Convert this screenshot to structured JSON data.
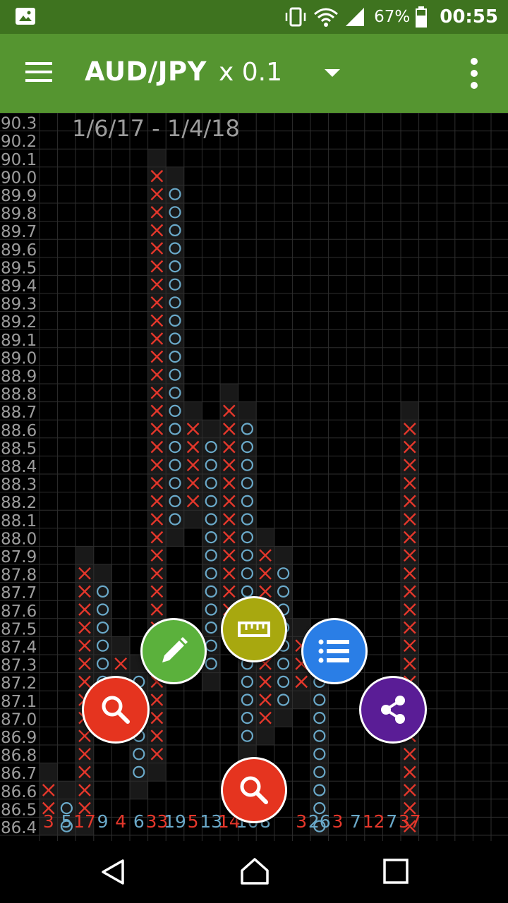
{
  "status_bar": {
    "battery": "67%",
    "time": "00:55",
    "icons": [
      "gallery-icon",
      "vibrate-icon",
      "wifi-icon",
      "signal-icon",
      "battery-icon"
    ]
  },
  "app_bar": {
    "symbol": "AUD/JPY",
    "box_size": "x 0.1",
    "icons": [
      "menu-icon",
      "dropdown-arrow-icon",
      "overflow-menu-icon"
    ]
  },
  "chart_data": {
    "type": "point-and-figure",
    "date_range": "1/6/17 - 1/4/18",
    "box_size": 0.1,
    "y_axis_labels": [
      "90.3",
      "90.2",
      "90.1",
      "90.0",
      "89.9",
      "89.8",
      "89.7",
      "89.6",
      "89.5",
      "89.4",
      "89.3",
      "89.2",
      "89.1",
      "89.0",
      "88.9",
      "88.8",
      "88.7",
      "88.6",
      "88.5",
      "88.4",
      "88.3",
      "88.2",
      "88.1",
      "88.0",
      "87.9",
      "87.8",
      "87.7",
      "87.6",
      "87.5",
      "87.4",
      "87.3",
      "87.2",
      "87.1",
      "87.0",
      "86.9",
      "86.8",
      "86.7",
      "86.6",
      "86.5",
      "86.4"
    ],
    "columns": [
      {
        "col": 0,
        "type": "X",
        "low": 86.5,
        "high": 86.6
      },
      {
        "col": 1,
        "type": "O",
        "low": 86.4,
        "high": 86.5
      },
      {
        "col": 2,
        "type": "X",
        "low": 86.5,
        "high": 87.8
      },
      {
        "col": 3,
        "type": "O",
        "low": 87.2,
        "high": 87.7
      },
      {
        "col": 4,
        "type": "X",
        "low": 87.3,
        "high": 87.3
      },
      {
        "col": 5,
        "type": "O",
        "low": 86.7,
        "high": 87.2
      },
      {
        "col": 6,
        "type": "X",
        "low": 86.8,
        "high": 90.0
      },
      {
        "col": 7,
        "type": "O",
        "low": 88.1,
        "high": 89.9
      },
      {
        "col": 8,
        "type": "X",
        "low": 88.2,
        "high": 88.6
      },
      {
        "col": 9,
        "type": "O",
        "low": 87.3,
        "high": 88.5
      },
      {
        "col": 10,
        "type": "X",
        "low": 87.6,
        "high": 88.7
      },
      {
        "col": 11,
        "type": "O",
        "low": 86.9,
        "high": 88.6
      },
      {
        "col": 12,
        "type": "X",
        "low": 87.0,
        "high": 87.9
      },
      {
        "col": 13,
        "type": "O",
        "low": 87.1,
        "high": 87.8
      },
      {
        "col": 14,
        "type": "X",
        "low": 87.2,
        "high": 87.4
      },
      {
        "col": 15,
        "type": "O",
        "low": 86.4,
        "high": 87.2
      },
      {
        "col": 20,
        "type": "X",
        "low": 86.4,
        "high": 88.6
      }
    ],
    "bottom_labels": [
      {
        "col": 0,
        "text": "3",
        "color": "#e5372b"
      },
      {
        "col": 1,
        "text": "5",
        "color": "#6aa9c9"
      },
      {
        "col": 2,
        "text": "17",
        "color": "#e5372b"
      },
      {
        "col": 3,
        "text": "9",
        "color": "#6aa9c9"
      },
      {
        "col": 4,
        "text": "4",
        "color": "#e5372b"
      },
      {
        "col": 5,
        "text": "6",
        "color": "#6aa9c9"
      },
      {
        "col": 6,
        "text": "33",
        "color": "#e5372b"
      },
      {
        "col": 7,
        "text": "19",
        "color": "#6aa9c9"
      },
      {
        "col": 8,
        "text": "5",
        "color": "#e5372b"
      },
      {
        "col": 9,
        "text": "13",
        "color": "#6aa9c9"
      },
      {
        "col": 10,
        "text": "14",
        "color": "#e5372b"
      },
      {
        "col": 11,
        "text": "16",
        "color": "#6aa9c9"
      },
      {
        "col": 12,
        "text": "8",
        "color": "#6aa9c9"
      },
      {
        "col": 14,
        "text": "3",
        "color": "#e5372b"
      },
      {
        "col": 15,
        "text": "26",
        "color": "#6aa9c9"
      },
      {
        "col": 16,
        "text": "3",
        "color": "#e5372b"
      },
      {
        "col": 17,
        "text": "7",
        "color": "#6aa9c9"
      },
      {
        "col": 18,
        "text": "12",
        "color": "#e5372b"
      },
      {
        "col": 19,
        "text": "7",
        "color": "#6aa9c9"
      },
      {
        "col": 20,
        "text": "37",
        "color": "#e5372b"
      }
    ],
    "colors": {
      "x": "#e5372b",
      "o": "#6aa9c9",
      "grid": "#2e2e2e",
      "axis_text": "#9c9c9c",
      "column_shade": "#191919"
    }
  },
  "fabs": [
    {
      "name": "edit-fab",
      "icon": "pencil-icon",
      "color": "#5bb13c"
    },
    {
      "name": "ruler-fab",
      "icon": "ruler-icon",
      "color": "#a8a80f"
    },
    {
      "name": "list-fab",
      "icon": "list-icon",
      "color": "#2a7ee6"
    },
    {
      "name": "share-fab",
      "icon": "share-icon",
      "color": "#5a1d96"
    },
    {
      "name": "zoom-fab",
      "icon": "zoom-icon",
      "color": "#e5341f"
    },
    {
      "name": "zoom-bottom-fab",
      "icon": "zoom-icon",
      "color": "#e5341f"
    }
  ],
  "nav_bar": {
    "icons": [
      "back-icon",
      "home-icon",
      "recents-icon"
    ]
  }
}
